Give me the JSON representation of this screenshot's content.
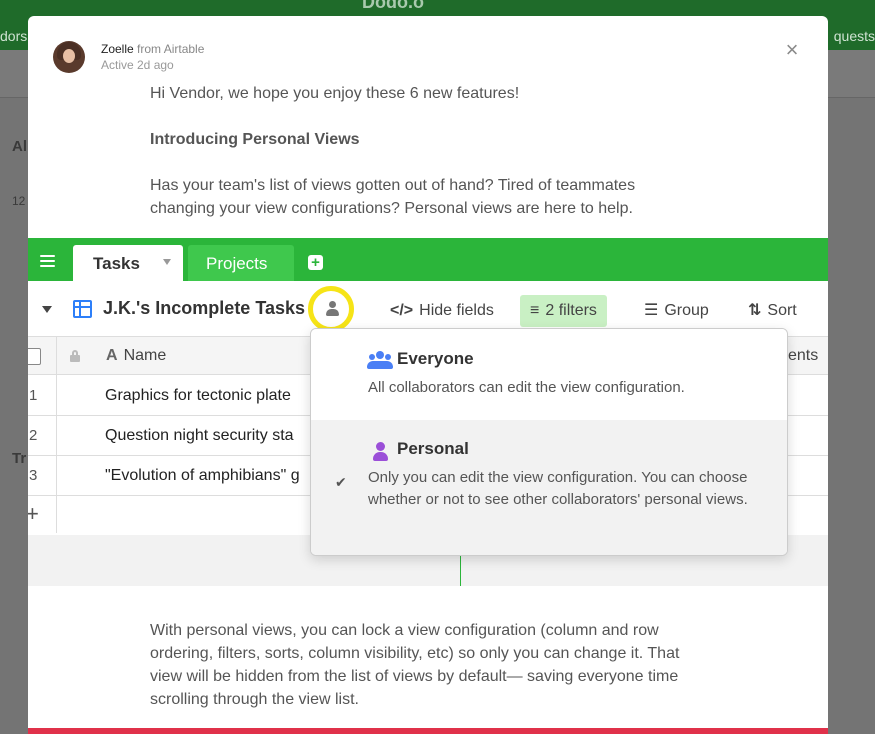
{
  "background": {
    "title": "Dodo.o",
    "left_text": "dors",
    "right_text": "quests",
    "left_panel_letters": [
      "Al",
      "Tr"
    ],
    "left_panel_number": "12"
  },
  "modal": {
    "sender_name": "Zoelle",
    "sender_from": "from Airtable",
    "active_status": "Active 2d ago",
    "close_label": "×",
    "greeting": "Hi Vendor, we hope you enjoy these 6 new features!",
    "heading": "Introducing Personal Views",
    "intro": "Has your team's list of views gotten out of hand? Tired of teammates changing your view configurations? Personal views are here to help.",
    "outro": "With personal views, you can lock a view configuration (column and row ordering, filters, sorts, column visibility, etc) so only you can change it. That view will be hidden from the list of views by default— saving everyone time scrolling through the view list."
  },
  "screenshot": {
    "tabs": [
      {
        "label": "Tasks",
        "active": true
      },
      {
        "label": "Projects",
        "active": false
      }
    ],
    "add_tab_label": "+",
    "view_name": "J.K.'s Incomplete Tasks",
    "toolbar": {
      "hide_fields": "Hide fields",
      "filters": "2 filters",
      "group": "Group",
      "sort": "Sort"
    },
    "columns": {
      "name": "Name",
      "right": "ents"
    },
    "rows": [
      {
        "num": "1",
        "text": "Graphics for tectonic plate"
      },
      {
        "num": "2",
        "text": "Question night security sta"
      },
      {
        "num": "3",
        "text": "\"Evolution of amphibians\" g"
      }
    ],
    "add_row_label": "+",
    "popup": {
      "everyone_title": "Everyone",
      "everyone_desc": "All collaborators can edit the view configuration.",
      "personal_title": "Personal",
      "personal_desc": "Only you can edit the view configuration. You can choose whether or not to see other collaborators' personal views.",
      "selected": "personal"
    }
  },
  "colors": {
    "brand_green": "#2bb53a",
    "highlight_yellow": "#f6e417",
    "filter_bg": "#c9f0c4",
    "grid_icon_blue": "#2d7ff9",
    "everyone_icon": "#4a7ff5",
    "personal_icon": "#9b4fd8",
    "bottom_bar": "#e0314a"
  }
}
